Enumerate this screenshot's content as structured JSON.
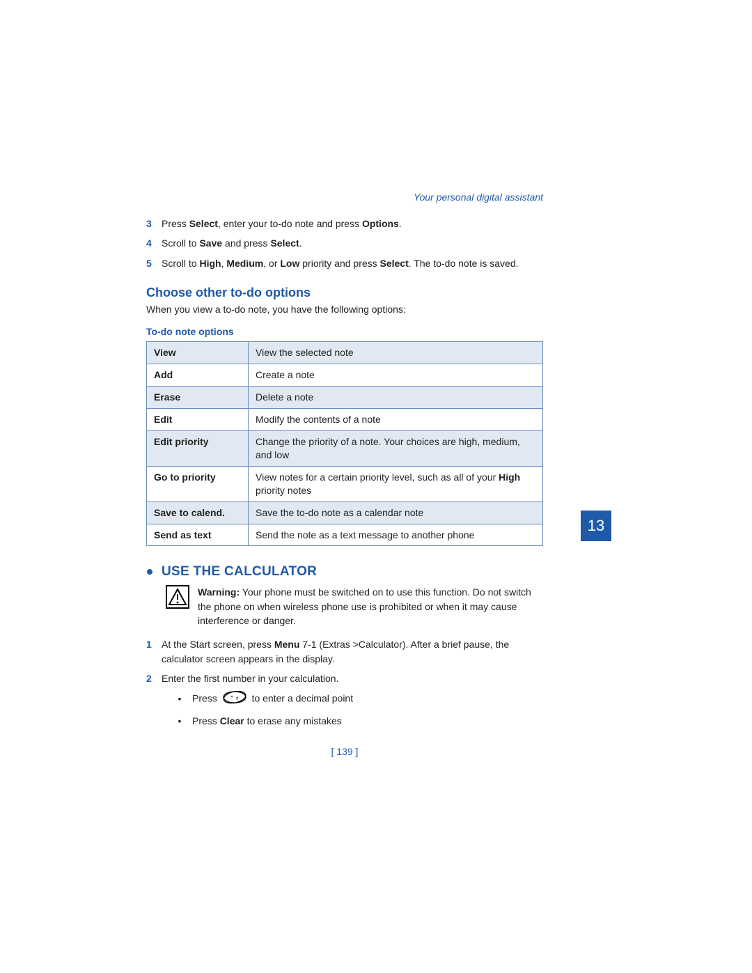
{
  "header": {
    "right": "Your personal digital assistant"
  },
  "steps_top": [
    {
      "num": "3",
      "segments": [
        {
          "t": "Press "
        },
        {
          "t": "Select",
          "b": true
        },
        {
          "t": ", enter your to-do note and press "
        },
        {
          "t": "Options",
          "b": true
        },
        {
          "t": "."
        }
      ]
    },
    {
      "num": "4",
      "segments": [
        {
          "t": "Scroll to "
        },
        {
          "t": "Save",
          "b": true
        },
        {
          "t": " and press "
        },
        {
          "t": "Select",
          "b": true
        },
        {
          "t": "."
        }
      ]
    },
    {
      "num": "5",
      "segments": [
        {
          "t": "Scroll to "
        },
        {
          "t": "High",
          "b": true
        },
        {
          "t": ", "
        },
        {
          "t": "Medium",
          "b": true
        },
        {
          "t": ", or "
        },
        {
          "t": "Low",
          "b": true
        },
        {
          "t": " priority and press "
        },
        {
          "t": "Select",
          "b": true
        },
        {
          "t": ". The to-do note is saved."
        }
      ]
    }
  ],
  "section_choose": {
    "title": "Choose other to-do options",
    "intro": "When you view a to-do note, you have the following options:"
  },
  "table": {
    "caption": "To-do note options",
    "rows": [
      {
        "shade": true,
        "left": "View",
        "right": [
          {
            "t": "View the selected note"
          }
        ]
      },
      {
        "shade": false,
        "left": "Add",
        "right": [
          {
            "t": "Create a note"
          }
        ]
      },
      {
        "shade": true,
        "left": "Erase",
        "right": [
          {
            "t": "Delete a note"
          }
        ]
      },
      {
        "shade": false,
        "left": "Edit",
        "right": [
          {
            "t": "Modify the contents of a note"
          }
        ]
      },
      {
        "shade": true,
        "left": "Edit priority",
        "right": [
          {
            "t": "Change the priority of a note. Your choices are high, medium, and low"
          }
        ]
      },
      {
        "shade": false,
        "left": "Go to priority",
        "right": [
          {
            "t": "View notes for a certain priority level, such as all of your "
          },
          {
            "t": "High",
            "b": true
          },
          {
            "t": " priority notes"
          }
        ]
      },
      {
        "shade": true,
        "left": "Save to calend.",
        "right": [
          {
            "t": "Save the to-do note as a calendar note"
          }
        ]
      },
      {
        "shade": false,
        "left": "Send as text",
        "right": [
          {
            "t": "Send the note as a text message to another phone"
          }
        ]
      }
    ]
  },
  "section_calc": {
    "title": "USE THE CALCULATOR",
    "warning": [
      {
        "t": "Warning:",
        "b": true
      },
      {
        "t": "  Your phone must be switched on to use this function. Do not switch the phone on when wireless phone use is prohibited or when it may cause interference or danger."
      }
    ],
    "steps": [
      {
        "num": "1",
        "segments": [
          {
            "t": "At the Start screen, press "
          },
          {
            "t": "Menu",
            "b": true
          },
          {
            "t": " 7-1 (Extras >Calculator). After a brief pause, the calculator screen appears in the display."
          }
        ]
      },
      {
        "num": "2",
        "segments": [
          {
            "t": "Enter the first number in your calculation."
          }
        ],
        "bullets": [
          {
            "pre": "Press ",
            "icon": true,
            "post": " to enter a decimal point"
          },
          {
            "segments": [
              {
                "t": "Press "
              },
              {
                "t": "Clear",
                "b": true
              },
              {
                "t": " to erase any mistakes"
              }
            ]
          }
        ]
      }
    ]
  },
  "side_tab": "13",
  "page_number": "[ 139 ]"
}
